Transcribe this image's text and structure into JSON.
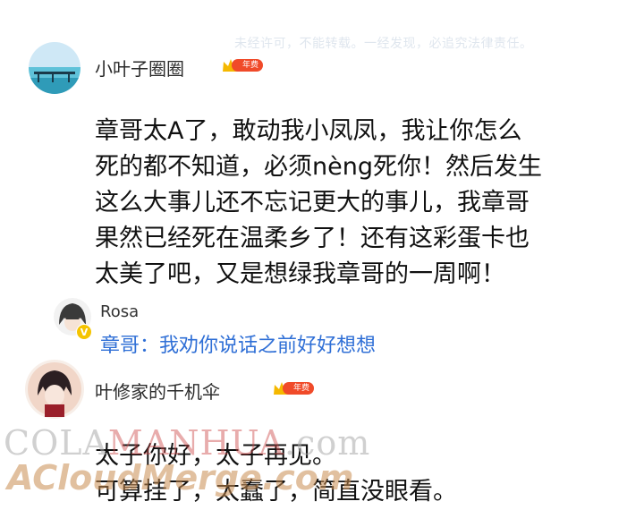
{
  "notice": "未经许可，不能转载。一经发现，必追究法律责任。",
  "comments": [
    {
      "username": "小叶子圈圈",
      "badge_text": "年费",
      "lines": [
        "章哥太A了，敢动我小凤凤，我让你怎么",
        "死的都不知道，必须nèng死你！然后发生",
        "这么大事儿还不忘记更大的事儿，我章哥",
        "果然已经死在温柔乡了！还有这彩蛋卡也",
        "太美了吧，又是想绿我章哥的一周啊！"
      ]
    },
    {
      "username": "Rosa",
      "verified_icon": "V",
      "reply_text": "章哥：我劝你说话之前好好想想"
    },
    {
      "username": "叶修家的千机伞",
      "badge_text": "年费",
      "lines": [
        "太子你好，太子再见。",
        "可算挂了，太蠢了，简直没眼看。"
      ]
    }
  ],
  "watermarks": {
    "line1_a": "COLA",
    "line1_b": "MANHUA",
    "line1_c": ".com",
    "line2": "ACloudMerge.com"
  },
  "colors": {
    "reply_blue": "#2f6fd6",
    "badge_red": "#f04a29",
    "crown_gold": "#f5b800"
  }
}
